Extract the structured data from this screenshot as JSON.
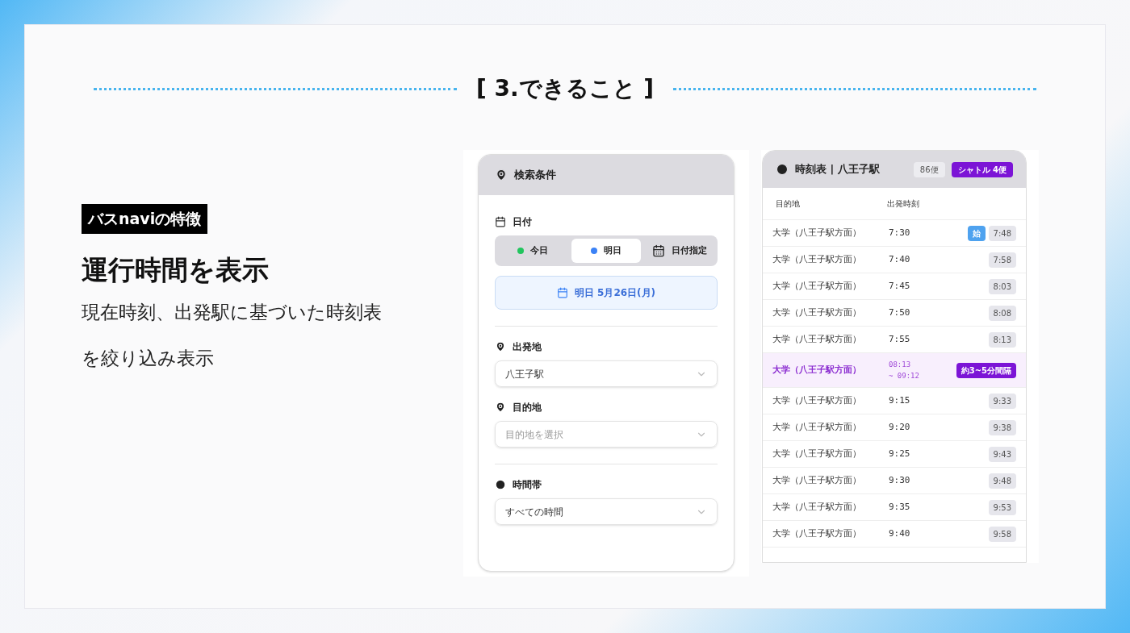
{
  "slide_title": "[ 3.できること ]",
  "feature_tag": "バスnaviの特徴",
  "heading": "運行時間を表示",
  "description": [
    "現在時刻、出発駅に基づいた時刻表",
    "を絞り込み表示"
  ],
  "search_panel": {
    "title": "検索条件",
    "date_label": "日付",
    "date_options": [
      {
        "label": "今日",
        "kind": "dot",
        "color": "#22c55e",
        "selected": false
      },
      {
        "label": "明日",
        "kind": "dot",
        "color": "#3b82f6",
        "selected": true
      },
      {
        "label": "日付指定",
        "kind": "calendar",
        "selected": false
      }
    ],
    "selected_date": "明日 5月26日(月)",
    "fields": [
      {
        "label": "出発地",
        "value": "八王子駅"
      },
      {
        "label": "目的地",
        "placeholder": "目的地を選択"
      },
      {
        "label": "時間帯",
        "value": "すべての時間"
      }
    ]
  },
  "timetable": {
    "title": "時刻表 | 八王子駅",
    "count": "86便",
    "shuttle_badge": "シャトル 4便",
    "columns": [
      "目的地",
      "出発時刻"
    ],
    "rows": [
      {
        "kind": "normal",
        "destination": "大学（八王子駅方面）",
        "departure": "7:30",
        "tag": "始",
        "arrival": "7:48"
      },
      {
        "kind": "normal",
        "destination": "大学（八王子駅方面）",
        "departure": "7:40",
        "arrival": "7:58"
      },
      {
        "kind": "normal",
        "destination": "大学（八王子駅方面）",
        "departure": "7:45",
        "arrival": "8:03"
      },
      {
        "kind": "normal",
        "destination": "大学（八王子駅方面）",
        "departure": "7:50",
        "arrival": "8:08"
      },
      {
        "kind": "normal",
        "destination": "大学（八王子駅方面）",
        "departure": "7:55",
        "arrival": "8:13"
      },
      {
        "kind": "shuttle",
        "destination": "大学（八王子駅方面）",
        "departure": "08:13",
        "departure_end": "~ 09:12",
        "interval": "約3~5分間隔"
      },
      {
        "kind": "normal",
        "destination": "大学（八王子駅方面）",
        "departure": "9:15",
        "arrival": "9:33"
      },
      {
        "kind": "normal",
        "destination": "大学（八王子駅方面）",
        "departure": "9:20",
        "arrival": "9:38"
      },
      {
        "kind": "normal",
        "destination": "大学（八王子駅方面）",
        "departure": "9:25",
        "arrival": "9:43"
      },
      {
        "kind": "normal",
        "destination": "大学（八王子駅方面）",
        "departure": "9:30",
        "arrival": "9:48"
      },
      {
        "kind": "normal",
        "destination": "大学（八王子駅方面）",
        "departure": "9:35",
        "arrival": "9:53"
      },
      {
        "kind": "normal",
        "destination": "大学（八王子駅方面）",
        "departure": "9:40",
        "arrival": "9:58"
      }
    ]
  }
}
